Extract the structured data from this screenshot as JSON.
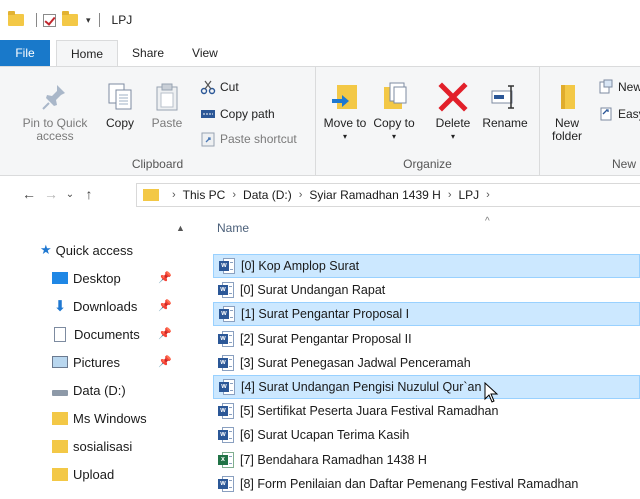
{
  "window": {
    "title": "LPJ"
  },
  "tabs": {
    "file": "File",
    "home": "Home",
    "share": "Share",
    "view": "View"
  },
  "ribbon": {
    "clipboard": {
      "label": "Clipboard",
      "pin": "Pin to Quick access",
      "copy": "Copy",
      "paste": "Paste",
      "cut": "Cut",
      "copy_path": "Copy path",
      "paste_shortcut": "Paste shortcut"
    },
    "organize": {
      "label": "Organize",
      "move_to": "Move to",
      "copy_to": "Copy to",
      "delete": "Delete",
      "rename": "Rename"
    },
    "new": {
      "label": "New",
      "new_folder": "New folder",
      "new_item": "New",
      "easy_access": "Easy"
    }
  },
  "address": {
    "crumbs": [
      "This PC",
      "Data (D:)",
      "Syiar Ramadhan 1439 H",
      "LPJ"
    ]
  },
  "nav": {
    "quick_access": "Quick access",
    "items": [
      {
        "label": "Desktop",
        "pinned": true
      },
      {
        "label": "Downloads",
        "pinned": true
      },
      {
        "label": "Documents",
        "pinned": true
      },
      {
        "label": "Pictures",
        "pinned": true
      },
      {
        "label": "Data (D:)",
        "pinned": false
      },
      {
        "label": "Ms Windows",
        "pinned": false
      },
      {
        "label": "sosialisasi",
        "pinned": false
      },
      {
        "label": "Upload",
        "pinned": false
      }
    ]
  },
  "list": {
    "column_name": "Name",
    "files": [
      {
        "name": "[0] Kop Amplop Surat",
        "type": "word",
        "selected": true
      },
      {
        "name": "[0] Surat Undangan Rapat",
        "type": "word",
        "selected": false
      },
      {
        "name": "[1] Surat Pengantar Proposal I",
        "type": "word",
        "selected": true
      },
      {
        "name": "[2] Surat Pengantar Proposal II",
        "type": "word",
        "selected": false
      },
      {
        "name": "[3] Surat Penegasan Jadwal Penceramah",
        "type": "word",
        "selected": false
      },
      {
        "name": "[4] Surat Undangan Pengisi Nuzulul Qur`an",
        "type": "word",
        "selected": true
      },
      {
        "name": "[5] Sertifikat Peserta Juara Festival Ramadhan",
        "type": "word",
        "selected": false
      },
      {
        "name": "[6] Surat Ucapan Terima Kasih",
        "type": "word",
        "selected": false
      },
      {
        "name": "[7] Bendahara Ramadhan 1438 H",
        "type": "excel",
        "selected": false
      },
      {
        "name": "[8] Form Penilaian dan Daftar Pemenang Festival Ramadhan",
        "type": "word",
        "selected": false
      }
    ]
  },
  "colors": {
    "accent": "#1979ca",
    "selection": "#cce8ff",
    "selection_border": "#99d1ff"
  }
}
